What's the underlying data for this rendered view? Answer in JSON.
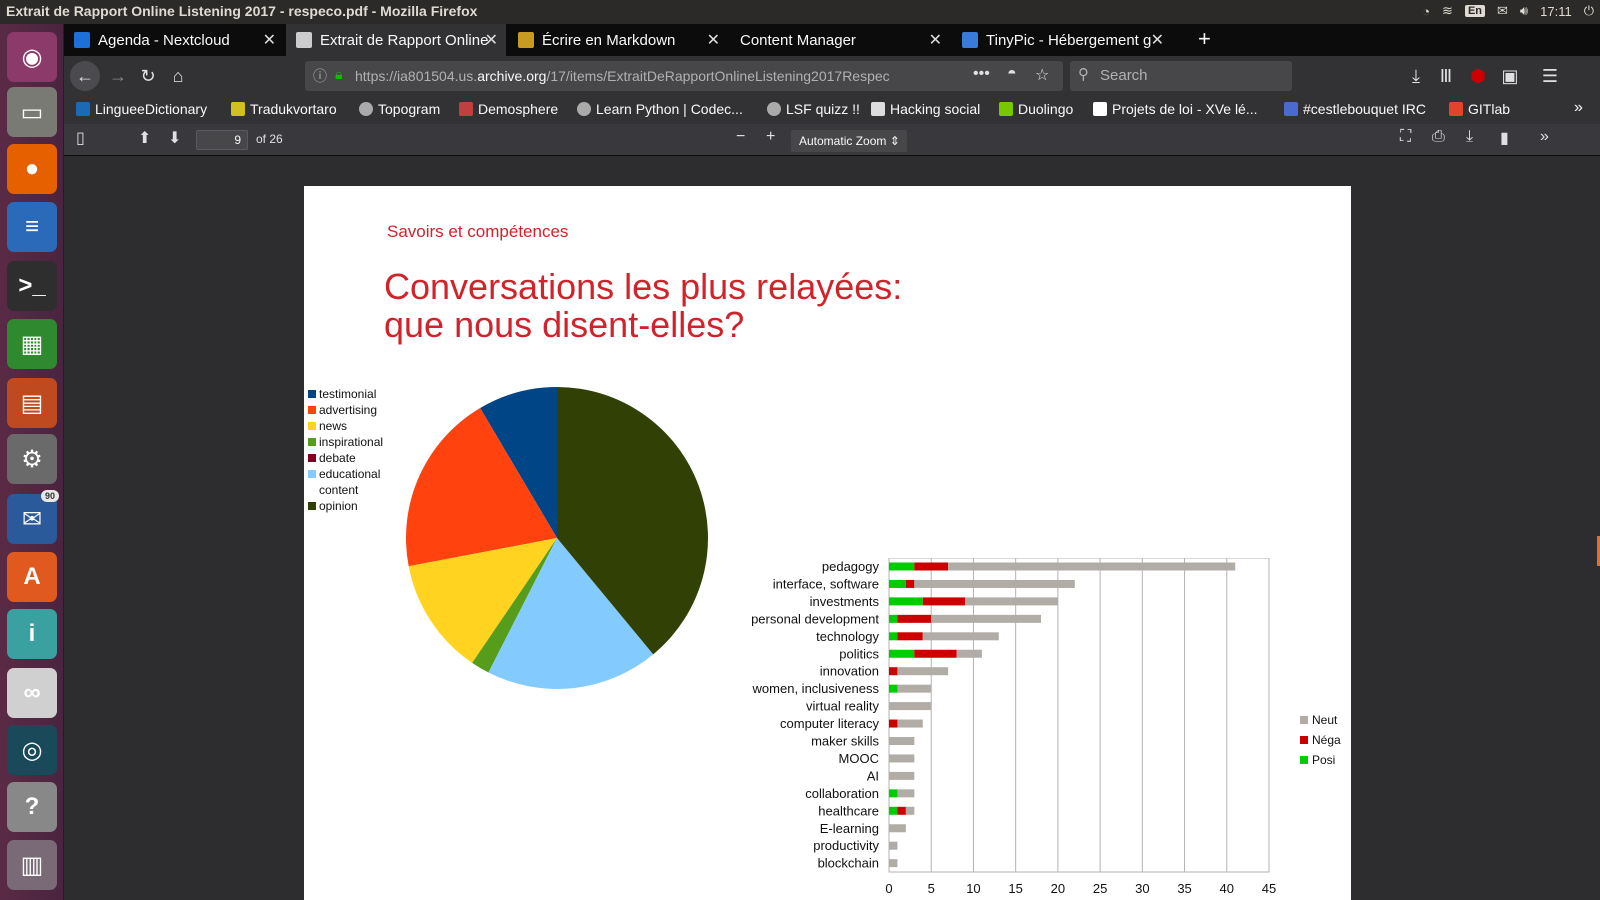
{
  "system": {
    "window_title": "Extrait de Rapport Online Listening 2017 - respeco.pdf - Mozilla Firefox",
    "keyboard_layout": "En",
    "clock": "17:11"
  },
  "launcher": {
    "items": [
      {
        "name": "ubuntu-dash-icon",
        "glyph": "◉",
        "bg": "#8c3a6a"
      },
      {
        "name": "files-icon",
        "glyph": "▭",
        "bg": "#7a7a74"
      },
      {
        "name": "firefox-icon",
        "glyph": "●",
        "bg": "#e66000"
      },
      {
        "name": "writer-icon",
        "glyph": "≡",
        "bg": "#2a6ab8"
      },
      {
        "name": "terminal-icon",
        "glyph": ">_",
        "bg": "#2e2e2e"
      },
      {
        "name": "calc-icon",
        "glyph": "▦",
        "bg": "#2f8a2f"
      },
      {
        "name": "impress-icon",
        "glyph": "▤",
        "bg": "#c04a20"
      },
      {
        "name": "settings-icon",
        "glyph": "⚙",
        "bg": "#6a6a6a"
      },
      {
        "name": "thunderbird-icon",
        "glyph": "✉",
        "bg": "#2a5a9a",
        "badge": "90"
      },
      {
        "name": "software-center-icon",
        "glyph": "A",
        "bg": "#e05a20"
      },
      {
        "name": "app-icon",
        "glyph": "i",
        "bg": "#3aa0a0"
      },
      {
        "name": "pdf-reader-icon",
        "glyph": "∞",
        "bg": "#d0d0d0"
      },
      {
        "name": "app-icon",
        "glyph": "◎",
        "bg": "#1a4a5a"
      },
      {
        "name": "help-icon",
        "glyph": "?",
        "bg": "#888888"
      },
      {
        "name": "trash-icon",
        "glyph": "▥",
        "bg": "#7a6a78"
      }
    ]
  },
  "tabs": [
    {
      "label": "Agenda - Nextcloud",
      "icon_color": "#1e6fd9"
    },
    {
      "label": "Extrait de Rapport Online",
      "icon_color": "#cccccc",
      "active": true
    },
    {
      "label": "Écrire en Markdown",
      "icon_color": "#c79a20"
    },
    {
      "label": "Content Manager",
      "icon_color": ""
    },
    {
      "label": "TinyPic - Hébergement g",
      "icon_color": "#3a7ad8"
    }
  ],
  "urlbar": {
    "url_prefix": "https://ia801504.us.",
    "url_host": "archive.org",
    "url_suffix": "/17/items/ExtraitDeRapportOnlineListening2017Respec"
  },
  "search": {
    "placeholder": "Search"
  },
  "bookmarks": [
    {
      "label": "LingueeDictionary",
      "color": "#1a6ab8"
    },
    {
      "label": "Tradukvortaro",
      "color": "#d0c020"
    },
    {
      "label": "Topogram",
      "color": "#aaaaaa"
    },
    {
      "label": "Demosphere",
      "color": "#c04040"
    },
    {
      "label": "Learn Python | Codec...",
      "color": "#aaaaaa"
    },
    {
      "label": "LSF quizz !!",
      "color": "#aaaaaa"
    },
    {
      "label": "Hacking social",
      "color": "#dddddd"
    },
    {
      "label": "Duolingo",
      "color": "#78c800"
    },
    {
      "label": "Projets de loi - XVe lé...",
      "color": "#ffffff"
    },
    {
      "label": "#cestlebouquet IRC",
      "color": "#4a6ad0"
    },
    {
      "label": "GITlab",
      "color": "#e24329"
    }
  ],
  "pdf": {
    "page_number": "9",
    "page_total": "of 26",
    "zoom": "Automatic Zoom",
    "section": "Savoirs et compétences",
    "title_line1": "Conversations les plus relayées:",
    "title_line2": "que nous disent-elles?"
  },
  "chart_data": [
    {
      "type": "pie",
      "labels": [
        "testimonial",
        "advertising",
        "news",
        "inspirational",
        "debate",
        "educational content",
        "opinion"
      ],
      "colors": [
        "#004586",
        "#ff420e",
        "#ffd320",
        "#579d1c",
        "#7e0021",
        "#83caff",
        "#314004"
      ],
      "values": [
        8.5,
        19.5,
        12.5,
        2,
        0,
        18.5,
        39
      ],
      "legend_position": "left"
    },
    {
      "type": "bar",
      "orientation": "horizontal",
      "stacked": true,
      "categories": [
        "pedagogy",
        "interface, software",
        "investments",
        "personal development",
        "technology",
        "politics",
        "innovation",
        "women, inclusiveness",
        "virtual reality",
        "computer literacy",
        "maker skills",
        "MOOC",
        "AI",
        "collaboration",
        "healthcare",
        "E-learning",
        "productivity",
        "blockchain"
      ],
      "series": [
        {
          "name": "Posi",
          "color": "#00cc00",
          "values": [
            3,
            2,
            4,
            1,
            1,
            3,
            0,
            1,
            0,
            0,
            0,
            0,
            0,
            1,
            1,
            0,
            0,
            0
          ]
        },
        {
          "name": "Néga",
          "color": "#cc0000",
          "values": [
            4,
            1,
            5,
            4,
            3,
            5,
            1,
            0,
            0,
            1,
            0,
            0,
            0,
            0,
            1,
            0,
            0,
            0
          ]
        },
        {
          "name": "Neut",
          "color": "#b2aca6",
          "values": [
            34,
            19,
            11,
            13,
            9,
            3,
            6,
            4,
            5,
            3,
            3,
            3,
            3,
            2,
            1,
            2,
            1,
            1
          ]
        }
      ],
      "xlim": [
        0,
        45
      ],
      "xticks": [
        "0",
        "5",
        "10",
        "15",
        "20",
        "25",
        "30",
        "35",
        "40",
        "45"
      ],
      "grid": true,
      "legend_position": "right"
    }
  ]
}
